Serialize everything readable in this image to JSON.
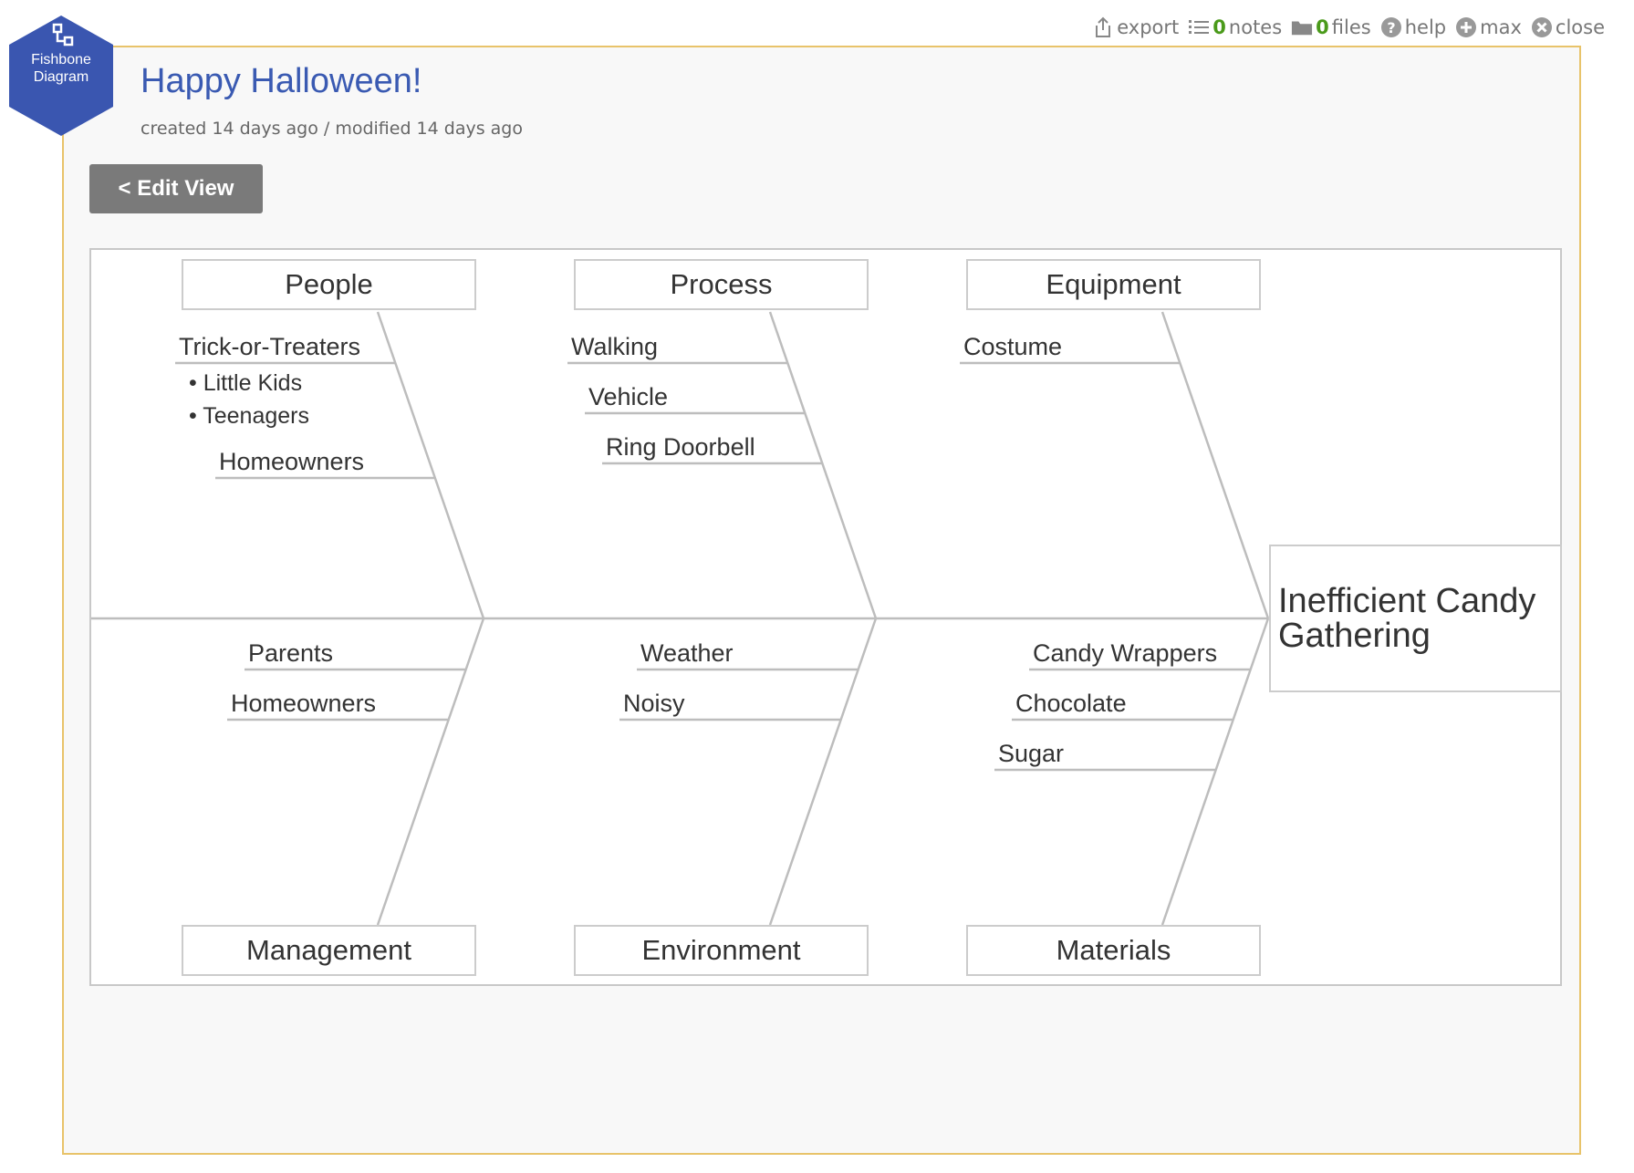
{
  "toolbar": {
    "export": "export",
    "notes_count": "0",
    "notes": "notes",
    "files_count": "0",
    "files": "files",
    "help": "help",
    "max": "max",
    "close": "close"
  },
  "badge": {
    "line1": "Fishbone",
    "line2": "Diagram",
    "color": "#3a56b0"
  },
  "header": {
    "title": "Happy Halloween!",
    "meta": "created 14 days ago / modified 14 days ago",
    "edit_button": "< Edit View"
  },
  "fishbone": {
    "effect": "Inefficient Candy Gathering",
    "top": [
      {
        "category": "People",
        "causes": [
          "Trick-or-Treaters",
          "Homeowners"
        ],
        "subcauses": [
          "Little Kids",
          "Teenagers"
        ]
      },
      {
        "category": "Process",
        "causes": [
          "Walking",
          "Vehicle",
          "Ring Doorbell"
        ]
      },
      {
        "category": "Equipment",
        "causes": [
          "Costume"
        ]
      }
    ],
    "bottom": [
      {
        "category": "Management",
        "causes": [
          "Parents",
          "Homeowners"
        ]
      },
      {
        "category": "Environment",
        "causes": [
          "Weather",
          "Noisy"
        ]
      },
      {
        "category": "Materials",
        "causes": [
          "Candy Wrappers",
          "Chocolate",
          "Sugar"
        ]
      }
    ]
  }
}
